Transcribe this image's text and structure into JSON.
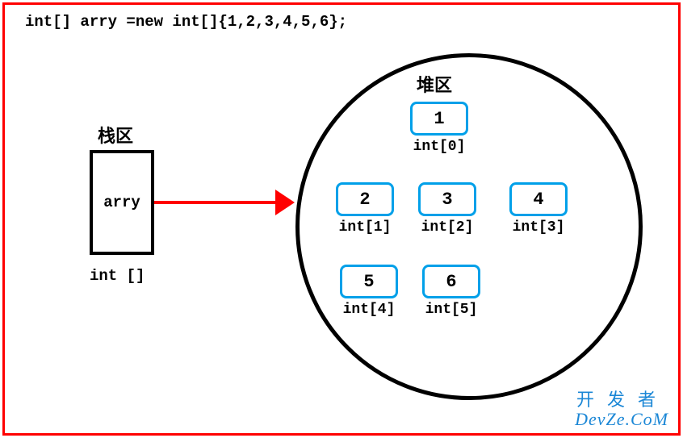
{
  "code": "int[] arry =new int[]{1,2,3,4,5,6};",
  "stack": {
    "title": "栈区",
    "variable": "arry",
    "type": "int []"
  },
  "heap": {
    "title": "堆区",
    "elements": [
      {
        "value": "1",
        "index": "int[0]"
      },
      {
        "value": "2",
        "index": "int[1]"
      },
      {
        "value": "3",
        "index": "int[2]"
      },
      {
        "value": "4",
        "index": "int[3]"
      },
      {
        "value": "5",
        "index": "int[4]"
      },
      {
        "value": "6",
        "index": "int[5]"
      }
    ]
  },
  "watermark": {
    "line1": "开发者",
    "line2": "DevZe.CoM"
  }
}
